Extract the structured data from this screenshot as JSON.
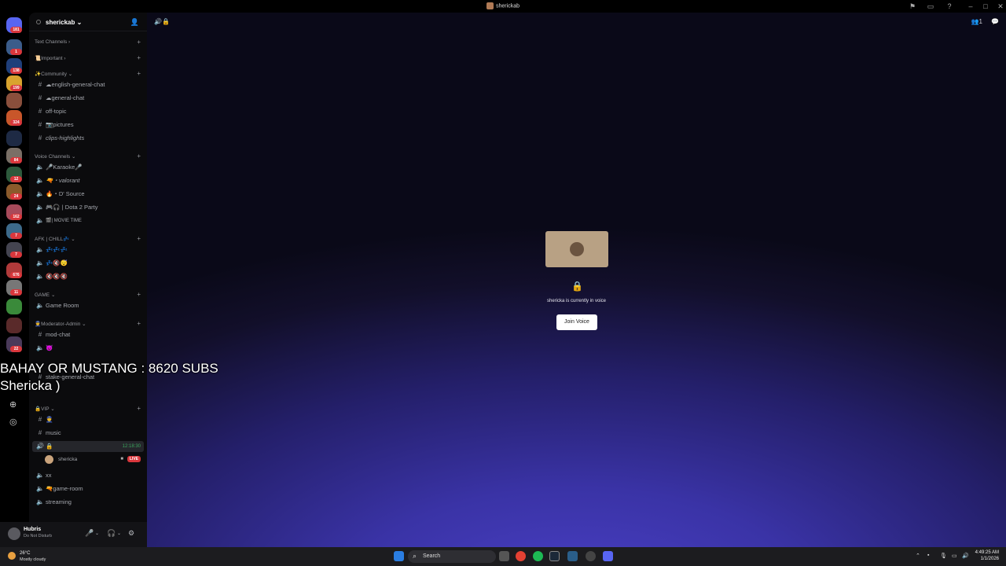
{
  "window": {
    "title": "sherickab"
  },
  "servers": {
    "home_badge": "181",
    "items": [
      {
        "badge": "1",
        "color": "#3b5c8a"
      },
      {
        "badge": "138",
        "color": "#1f3f7a"
      },
      {
        "badge": "199",
        "color": "#d9a32e"
      },
      {
        "badge": "",
        "color": "#8a4f3c"
      },
      {
        "badge": "324",
        "color": "#c8562a"
      },
      {
        "badge": "",
        "color": "#1e2a44"
      },
      {
        "badge": "84",
        "color": "#7a6f66"
      },
      {
        "badge": "12",
        "color": "#2d5a3c"
      },
      {
        "badge": "24",
        "color": "#8b5a2b"
      },
      {
        "badge": "162",
        "color": "#a84a5a"
      },
      {
        "badge": "7",
        "color": "#3d6a8a"
      },
      {
        "badge": "7",
        "color": "#444450"
      },
      {
        "badge": "676",
        "color": "#b03a3a"
      },
      {
        "badge": "11",
        "color": "#777"
      },
      {
        "badge": "",
        "color": "#3a8a3a"
      },
      {
        "badge": "",
        "color": "#5a2a2a"
      },
      {
        "badge": "22",
        "color": "#4a3a5a"
      }
    ]
  },
  "server": {
    "name": "sherickab"
  },
  "sidebar": {
    "categories": {
      "text": "Text Channels",
      "important": "📜Important",
      "community": "✨Community",
      "voice": "Voice Channels",
      "afk": "AFK | CHILL💤",
      "game": "GAME",
      "mod": "👮Moderator-Admin",
      "vip": "🔒VIP"
    },
    "channels": {
      "english": "☁english-general-chat",
      "general": "☁general-chat",
      "offtopic": "off-topic",
      "pictures": "📷pictures",
      "clips": "clips-highlights",
      "karaoke": "🎤Karaoke🎤",
      "valorant": "🔫・valorant",
      "dsource": "🔥・D' Source",
      "dota": "🎮🎧 | Dota 2 Party",
      "movie": "🎬| MOVIE TIME",
      "afk1": "💤💤💤",
      "afk2": "💤🔇😴",
      "afk3": "🔇🔇🔇",
      "gameroom": "Game Room",
      "modchat": "mod-chat",
      "mod2": "😈",
      "stake": "stake-general-chat",
      "vip1": "👮",
      "music": "music",
      "vip_voice": "🔒",
      "vip_timer": "12:18:30",
      "xx": "xx",
      "gameroom2": "🔫game-room",
      "streaming": "streaming"
    },
    "member": {
      "name": "shericka",
      "live": "LIVE"
    }
  },
  "user": {
    "name": "Hubris",
    "status": "Do Not Disturb"
  },
  "voice": {
    "status": "shericka is currently in voice",
    "join_label": "Join Voice"
  },
  "overlay": {
    "line1": "BAHAY OR MUSTANG : 8620 SUBS",
    "line2": "Shericka )"
  },
  "header": {
    "member_count": "1"
  },
  "taskbar": {
    "weather_temp": "26°C",
    "weather_cond": "Mostly cloudy",
    "search_placeholder": "Search",
    "time": "4:49:25 AM",
    "date": "1/1/2026"
  }
}
